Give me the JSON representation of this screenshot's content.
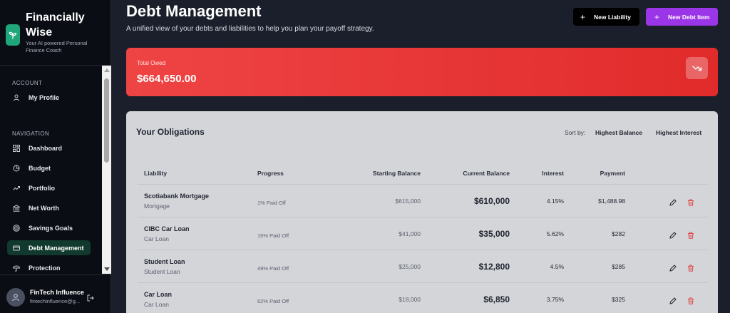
{
  "brand": {
    "title": "Financially Wise",
    "subtitle": "Your AI powered Personal Finance Coach",
    "accent": "#1fa67a"
  },
  "sidebar": {
    "account_label": "ACCOUNT",
    "account_items": [
      {
        "label": "My Profile",
        "icon": "user-icon"
      }
    ],
    "navigation_label": "NAVIGATION",
    "nav_items": [
      {
        "label": "Dashboard",
        "icon": "grid-icon"
      },
      {
        "label": "Budget",
        "icon": "pie-icon"
      },
      {
        "label": "Portfolio",
        "icon": "trend-icon"
      },
      {
        "label": "Net Worth",
        "icon": "bank-icon"
      },
      {
        "label": "Savings Goals",
        "icon": "target-icon"
      },
      {
        "label": "Debt Management",
        "icon": "card-icon",
        "active": true
      },
      {
        "label": "Protection",
        "icon": "umbrella-icon"
      }
    ],
    "user": {
      "name": "FinTech Influence",
      "email": "fintechinfluence@g..."
    }
  },
  "header": {
    "title": "Debt Management",
    "subtitle": "A unified view of your debts and liabilities to help you plan your payoff strategy.",
    "new_liability_label": "New Liability",
    "new_debt_item_label": "New Debt Item",
    "purple": "#9b35e8"
  },
  "total": {
    "label": "Total Owed",
    "value": "$664,650.00",
    "color": "#ef4444"
  },
  "obligations": {
    "title": "Your Obligations",
    "sort_label": "Sort by:",
    "sort_options": [
      "Highest Balance",
      "Highest Interest"
    ],
    "columns": [
      "Liability",
      "Progress",
      "Starting Balance",
      "Current Balance",
      "Interest",
      "Payment"
    ],
    "rows": [
      {
        "name": "Scotiabank Mortgage",
        "type": "Mortgage",
        "progress": "1% Paid Off",
        "start": "$615,000",
        "current": "$610,000",
        "interest": "4.15%",
        "payment": "$1,488.98"
      },
      {
        "name": "CIBC Car Loan",
        "type": "Car Loan",
        "progress": "15% Paid Off",
        "start": "$41,000",
        "current": "$35,000",
        "interest": "5.62%",
        "payment": "$282"
      },
      {
        "name": "Student Loan",
        "type": "Student Loan",
        "progress": "49% Paid Off",
        "start": "$25,000",
        "current": "$12,800",
        "interest": "4.5%",
        "payment": "$285"
      },
      {
        "name": "Car Loan",
        "type": "Car Loan",
        "progress": "62% Paid Off",
        "start": "$18,000",
        "current": "$6,850",
        "interest": "3.75%",
        "payment": "$325"
      }
    ]
  }
}
